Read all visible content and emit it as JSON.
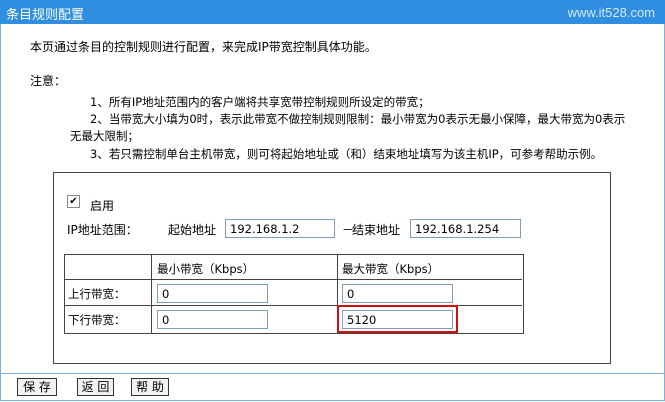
{
  "titlebar": {
    "title": "条目规则配置",
    "watermark": "www.it528.com"
  },
  "intro": "本页通过条目的控制规则进行配置，来完成IP带宽控制具体功能。",
  "notice": {
    "label": "注意：",
    "items": [
      "1、所有IP地址范围内的客户端将共享宽带控制规则所设定的带宽；",
      "2、当带宽大小填为0时，表示此带宽不做控制规则限制：最小带宽为0表示无最小保障，最大带宽为0表示",
      "无最大限制；",
      "3、若只需控制单台主机带宽，则可将起始地址或（和）结束地址填写为该主机IP，可参考帮助示例。"
    ]
  },
  "form": {
    "enable_label": "启用",
    "enable_checked": "✔",
    "ip_range_label": "IP地址范围：",
    "start_label": "起始地址",
    "start_value": "192.168.1.2",
    "dash": "－",
    "end_label": "结束地址",
    "end_value": "192.168.1.254"
  },
  "bandwidth": {
    "headers": [
      "最小带宽（Kbps）",
      "最大带宽（Kbps）"
    ],
    "rows": [
      {
        "label": "上行带宽：",
        "min": "0",
        "max": "0"
      },
      {
        "label": "下行带宽：",
        "min": "0",
        "max": "5120"
      }
    ]
  },
  "buttons": {
    "save": "保 存",
    "back": "返 回",
    "help": "帮 助"
  },
  "colors": {
    "titlebar": "#2f8ee0",
    "highlight": "#d01010"
  }
}
